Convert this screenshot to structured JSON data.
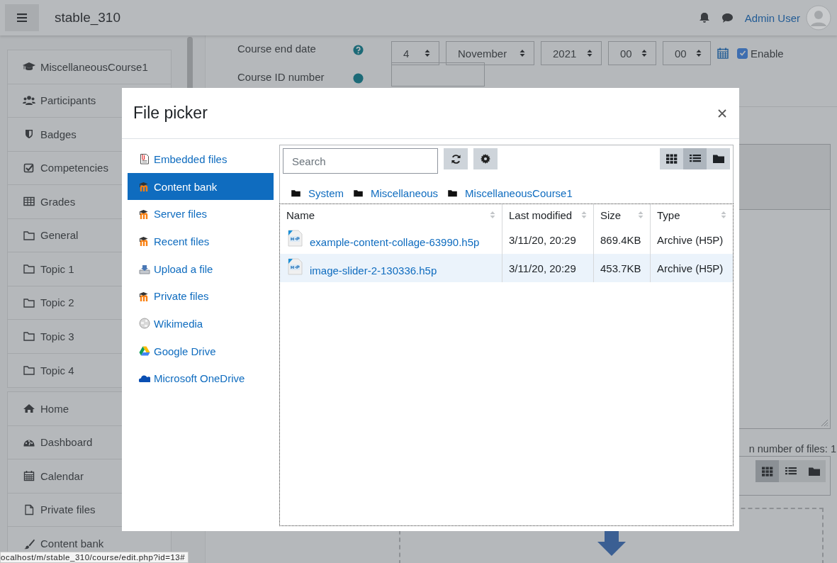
{
  "navbar": {
    "title": "stable_310",
    "user": "Admin User"
  },
  "sidebar": {
    "course_block": [
      {
        "label": "MiscellaneousCourse1",
        "kind": "course"
      },
      {
        "label": "Participants",
        "kind": "participants"
      },
      {
        "label": "Badges",
        "kind": "badges"
      },
      {
        "label": "Competencies",
        "kind": "competencies"
      },
      {
        "label": "Grades",
        "kind": "grades"
      },
      {
        "label": "General",
        "kind": "folder"
      },
      {
        "label": "Topic 1",
        "kind": "folder"
      },
      {
        "label": "Topic 2",
        "kind": "folder"
      },
      {
        "label": "Topic 3",
        "kind": "folder"
      },
      {
        "label": "Topic 4",
        "kind": "folder"
      }
    ],
    "site_block": [
      {
        "label": "Home",
        "kind": "home"
      },
      {
        "label": "Dashboard",
        "kind": "dashboard"
      },
      {
        "label": "Calendar",
        "kind": "calendar"
      },
      {
        "label": "Private files",
        "kind": "file"
      },
      {
        "label": "Content bank",
        "kind": "brush"
      }
    ]
  },
  "form": {
    "end_date": {
      "label": "Course end date",
      "day": "4",
      "month": "November",
      "year": "2021",
      "hour": "00",
      "minute": "00",
      "enable": {
        "label": "Enable",
        "checked": true
      }
    },
    "id_number": {
      "label": "Course ID number"
    },
    "files_note": "n number of files: 1",
    "view_buttons": [
      {
        "kind": "grid",
        "selected": true
      },
      {
        "kind": "list",
        "selected": false
      },
      {
        "kind": "folder",
        "selected": false
      }
    ]
  },
  "dialog": {
    "title": "File picker",
    "repositories": [
      {
        "label": "Embedded files",
        "kind": "embedded",
        "selected": false
      },
      {
        "label": "Content bank",
        "kind": "moodle",
        "selected": true
      },
      {
        "label": "Server files",
        "kind": "moodle",
        "selected": false
      },
      {
        "label": "Recent files",
        "kind": "moodle",
        "selected": false
      },
      {
        "label": "Upload a file",
        "kind": "upload",
        "selected": false
      },
      {
        "label": "Private files",
        "kind": "moodle",
        "selected": false
      },
      {
        "label": "Wikimedia",
        "kind": "wikimedia",
        "selected": false
      },
      {
        "label": "Google Drive",
        "kind": "gdrive",
        "selected": false
      },
      {
        "label": "Microsoft OneDrive",
        "kind": "onedrive",
        "selected": false
      }
    ],
    "search": {
      "placeholder": "Search"
    },
    "view_buttons": [
      {
        "kind": "grid",
        "selected": false
      },
      {
        "kind": "list",
        "selected": true
      },
      {
        "kind": "folder",
        "selected": false
      }
    ],
    "breadcrumb": [
      "System",
      "Miscellaneous",
      "MiscellaneousCourse1"
    ],
    "table": {
      "columns": [
        "Name",
        "Last modified",
        "Size",
        "Type"
      ],
      "rows": [
        {
          "name": "example-content-collage-63990.h5p",
          "modified": "3/11/20, 20:29",
          "size": "869.4KB",
          "type": "Archive (H5P)",
          "selected": false
        },
        {
          "name": "image-slider-2-130336.h5p",
          "modified": "3/11/20, 20:29",
          "size": "453.7KB",
          "type": "Archive (H5P)",
          "selected": true
        }
      ]
    }
  },
  "status_url": "ocalhost/m/stable_310/course/edit.php?id=13#"
}
